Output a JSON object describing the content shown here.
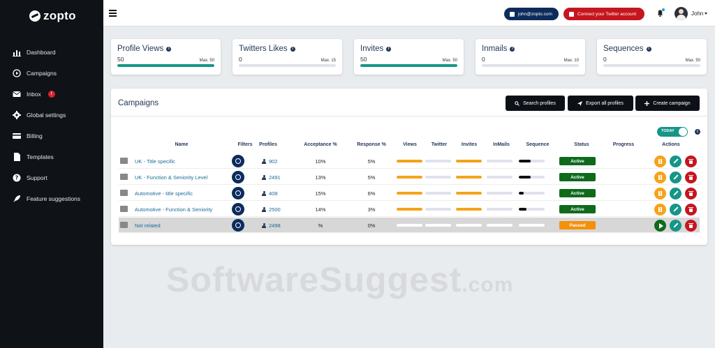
{
  "brand": {
    "name": "zopto"
  },
  "sidebar": {
    "items": [
      {
        "label": "Dashboard",
        "icon": "bar-chart-icon"
      },
      {
        "label": "Campaigns",
        "icon": "play-circle-icon"
      },
      {
        "label": "Inbox",
        "icon": "envelope-icon",
        "badge": "!"
      },
      {
        "label": "Global settings",
        "icon": "gear-icon"
      },
      {
        "label": "Billing",
        "icon": "credit-card-icon"
      },
      {
        "label": "Templates",
        "icon": "file-icon"
      },
      {
        "label": "Support",
        "icon": "question-circle-icon"
      },
      {
        "label": "Feature suggestions",
        "icon": "rocket-icon"
      }
    ]
  },
  "topbar": {
    "email": "john@zopto.com",
    "twitter_button": "Connect your Twitter account",
    "user_name": "John"
  },
  "stats": [
    {
      "title": "Profile Views",
      "value": "50",
      "max": "Max. 50",
      "fraction": 1.0
    },
    {
      "title": "Twitters Likes",
      "value": "0",
      "max": "Max. 15",
      "fraction": 0.0
    },
    {
      "title": "Invites",
      "value": "50",
      "max": "Max. 50",
      "fraction": 1.0
    },
    {
      "title": "Inmails",
      "value": "0",
      "max": "Max. 10",
      "fraction": 0.0
    },
    {
      "title": "Sequences",
      "value": "0",
      "max": "Max. 50",
      "fraction": 0.0
    }
  ],
  "campaigns": {
    "title": "Campaigns",
    "buttons": {
      "search": "Search profiles",
      "export": "Export all profiles",
      "create": "Create campaign"
    },
    "toggle_label": "TODAY",
    "columns": [
      "Name",
      "Filters",
      "Profiles",
      "Acceptance %",
      "Response %",
      "Views",
      "Twitter",
      "Invites",
      "InMails",
      "Sequence",
      "Status",
      "Progress",
      "Actions"
    ],
    "rows": [
      {
        "name": "UK - Title specific",
        "profiles": "902",
        "acceptance": "10%",
        "response": "5%",
        "views": 1.0,
        "twitter": 0.0,
        "invites": 1.0,
        "inmails": 0.0,
        "sequence": 0.45,
        "status": "Active",
        "paused": false
      },
      {
        "name": "UK - Function & Seniority Level",
        "profiles": "2491",
        "acceptance": "13%",
        "response": "5%",
        "views": 1.0,
        "twitter": 0.0,
        "invites": 1.0,
        "inmails": 0.0,
        "sequence": 0.45,
        "status": "Active",
        "paused": false
      },
      {
        "name": "Automotive - title specific",
        "profiles": "408",
        "acceptance": "15%",
        "response": "6%",
        "views": 1.0,
        "twitter": 0.0,
        "invites": 1.0,
        "inmails": 0.0,
        "sequence": 0.2,
        "status": "Active",
        "paused": false
      },
      {
        "name": "Automotive - Function & Seniority",
        "profiles": "2500",
        "acceptance": "14%",
        "response": "3%",
        "views": 1.0,
        "twitter": 0.0,
        "invites": 1.0,
        "inmails": 0.0,
        "sequence": 0.3,
        "status": "Active",
        "paused": false
      },
      {
        "name": "Not related",
        "profiles": "2498",
        "acceptance": "%",
        "response": "0%",
        "views": 0.0,
        "twitter": 0.0,
        "invites": 0.0,
        "inmails": 0.0,
        "sequence": 0.0,
        "status": "Paused",
        "paused": true
      }
    ]
  },
  "colors": {
    "teal": "#159687",
    "orange": "#f5a31a",
    "navy": "#0d2c5c",
    "green": "#0f6a1c",
    "red": "#c5161f",
    "paused": "#f5900a",
    "dark": "#0d1117"
  },
  "watermark": {
    "main": "SoftwareSuggest",
    "suffix": ".com"
  }
}
